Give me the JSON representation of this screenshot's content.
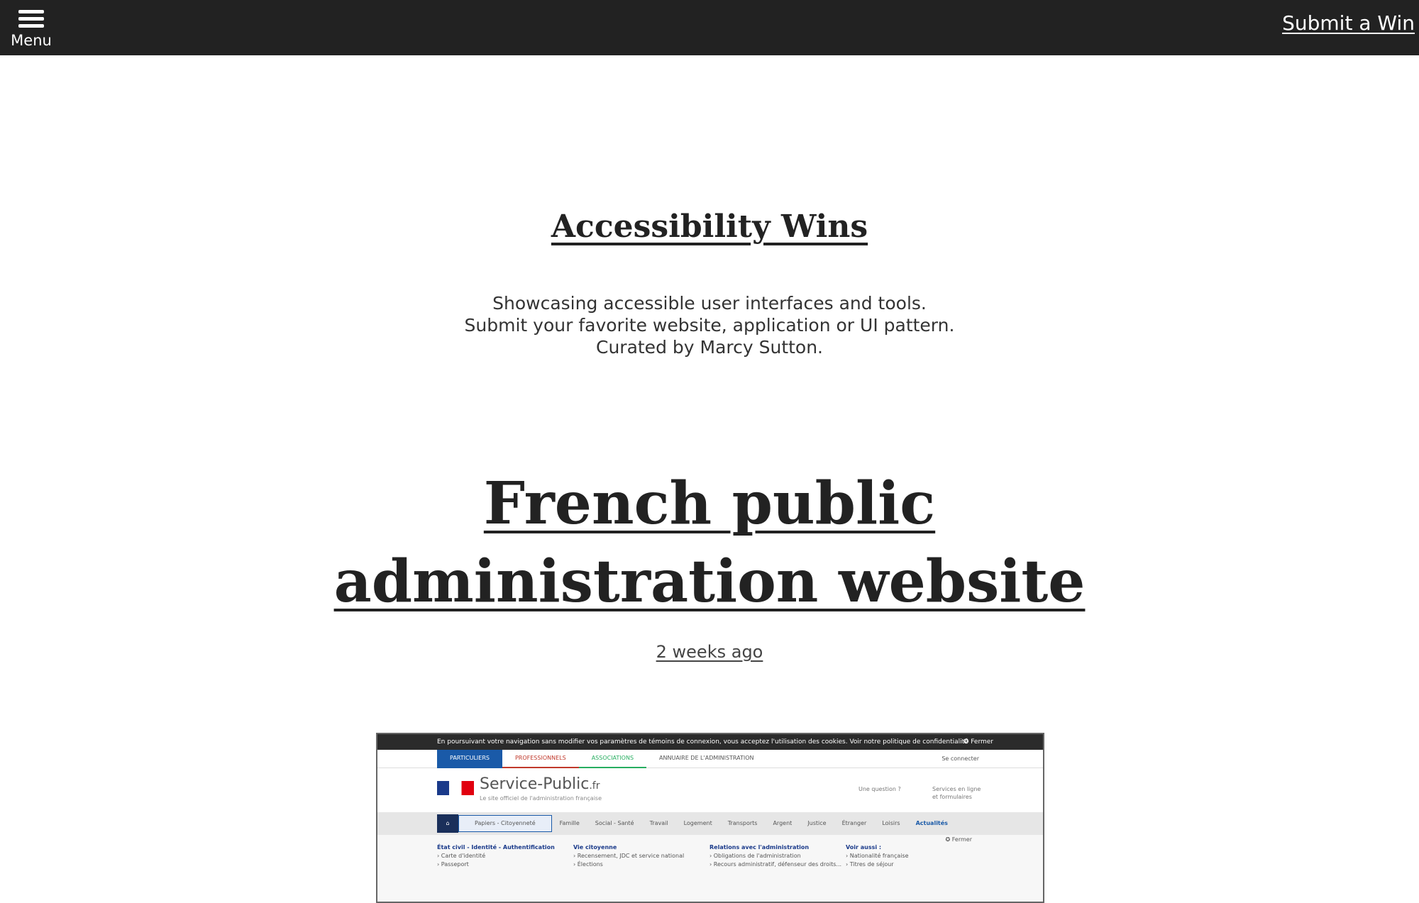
{
  "header": {
    "menu_label": "Menu",
    "submit_label": "Submit a Win"
  },
  "site": {
    "title": "Accessibility Wins",
    "tagline_lines": [
      "Showcasing accessible user interfaces and tools.",
      "Submit your favorite website, application or UI pattern.",
      "Curated by Marcy Sutton."
    ]
  },
  "post": {
    "title_lines": [
      "French public",
      "administration website"
    ],
    "date": "2 weeks ago"
  },
  "screenshot": {
    "cookie_text": "En poursuivant votre navigation sans modifier vos paramètres de témoins de connexion, vous acceptez l'utilisation des cookies.  Voir notre politique de confidentialité",
    "cookie_close": "✪ Fermer",
    "tabs": [
      "PARTICULIERS",
      "PROFESSIONNELS",
      "ASSOCIATIONS",
      "ANNUAIRE DE L'ADMINISTRATION"
    ],
    "login": "Se connecter",
    "logo_main": "Service-Public",
    "logo_suffix": ".fr",
    "slogan": "Le site officiel de l'administration française",
    "help": "Une question ?",
    "services": "Services en ligne et formulaires",
    "nav": [
      "Papiers - Citoyenneté",
      "Famille",
      "Social - Santé",
      "Travail",
      "Logement",
      "Transports",
      "Argent",
      "Justice",
      "Étranger",
      "Loisirs",
      "Actualités"
    ],
    "close2": "✪ Fermer",
    "columns": [
      {
        "heading": "État civil - Identité - Authentification",
        "items": [
          "› Carte d'identité",
          "› Passeport"
        ]
      },
      {
        "heading": "Vie citoyenne",
        "items": [
          "› Recensement, JDC et service national",
          "› Élections"
        ]
      },
      {
        "heading": "Relations avec l'administration",
        "items": [
          "› Obligations de l'administration",
          "› Recours administratif, défenseur des droits..."
        ]
      },
      {
        "heading": "Voir aussi :",
        "items": [
          "› Nationalité française",
          "› Titres de séjour"
        ]
      }
    ]
  }
}
